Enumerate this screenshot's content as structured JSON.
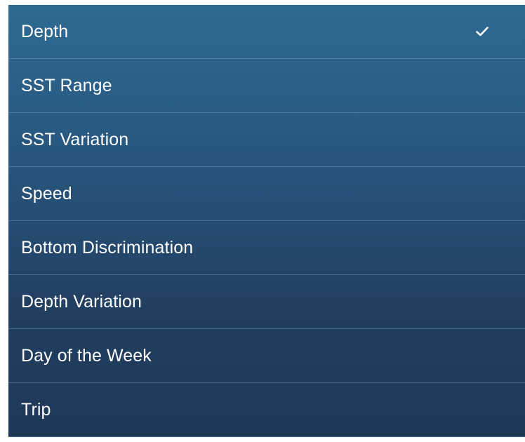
{
  "menu": {
    "items": [
      {
        "label": "Depth",
        "selected": true
      },
      {
        "label": "SST Range",
        "selected": false
      },
      {
        "label": "SST Variation",
        "selected": false
      },
      {
        "label": "Speed",
        "selected": false
      },
      {
        "label": "Bottom Discrimination",
        "selected": false
      },
      {
        "label": "Depth Variation",
        "selected": false
      },
      {
        "label": "Day of the Week",
        "selected": false
      },
      {
        "label": "Trip",
        "selected": false
      }
    ],
    "selected_icon": "check-icon"
  },
  "colors": {
    "panel_top": "#2e6a93",
    "panel_bottom": "#1e3858",
    "text": "#ffffff",
    "divider": "#8cb4d2"
  }
}
